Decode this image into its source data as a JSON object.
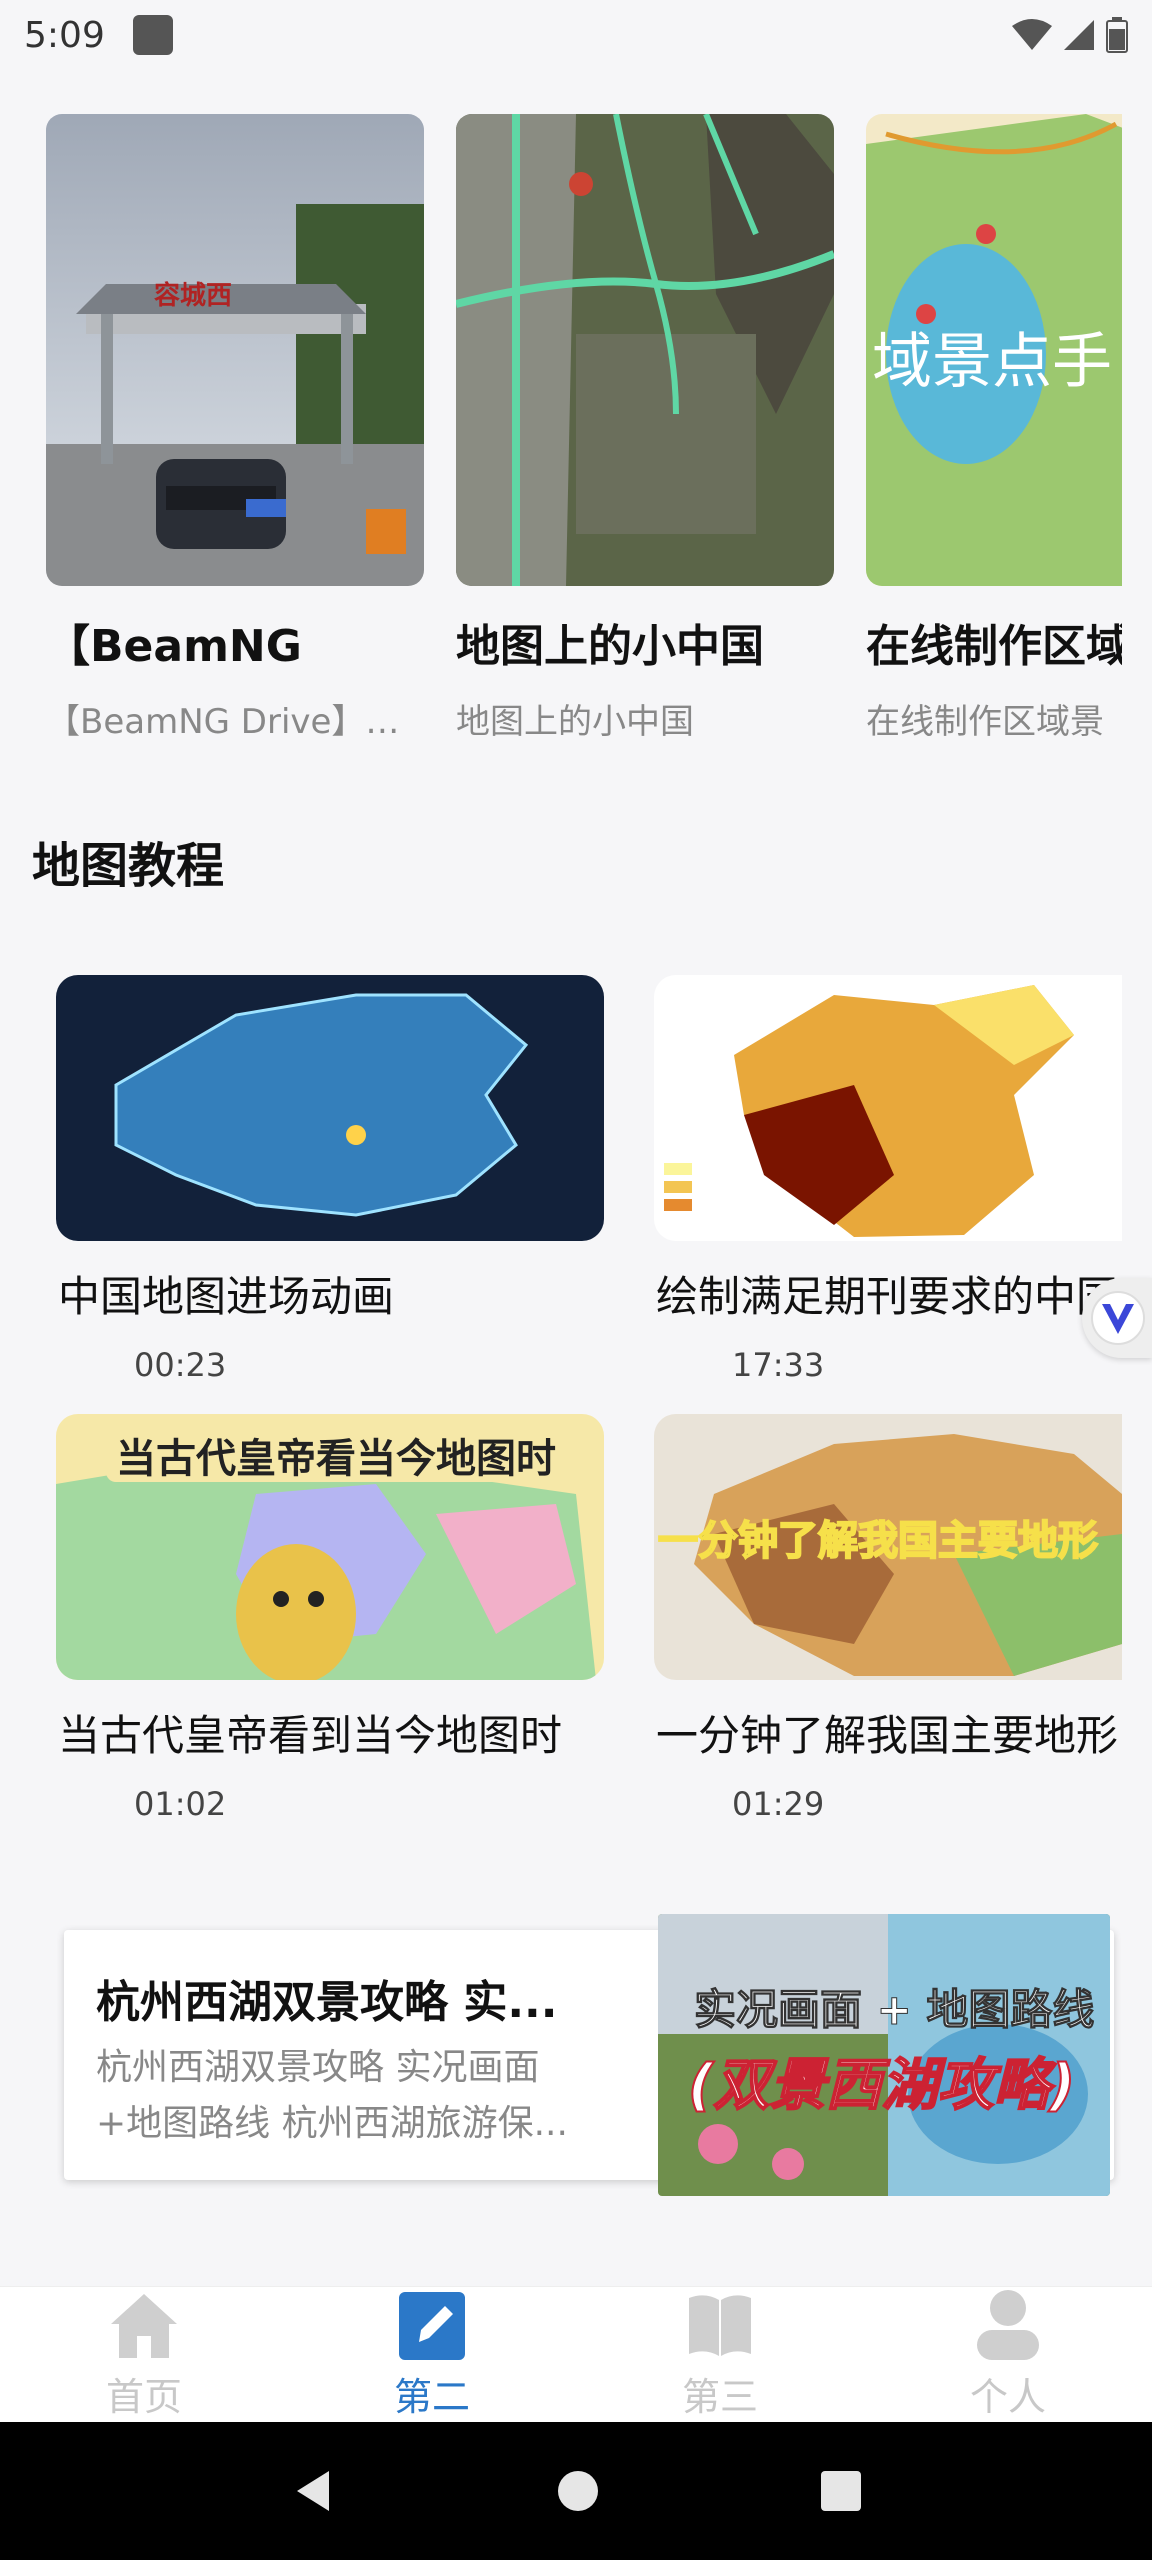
{
  "status": {
    "time": "5:09"
  },
  "carousel": [
    {
      "title": "【BeamNG",
      "subtitle": "【BeamNG Drive】…",
      "thumb_text": "容城西"
    },
    {
      "title": "地图上的小中国",
      "subtitle": "地图上的小中国"
    },
    {
      "title": "在线制作区域",
      "subtitle": "在线制作区域景",
      "thumb_text": "域景点手"
    }
  ],
  "section": {
    "title": "地图教程"
  },
  "videos": [
    {
      "title": "中国地图进场动画",
      "duration": "00:23"
    },
    {
      "title": "绘制满足期刊要求的中国",
      "duration": "17:33"
    },
    {
      "title": "当古代皇帝看到当今地图时",
      "duration": "01:02",
      "thumb_text": "当古代皇帝看当今地图时"
    },
    {
      "title": "一分钟了解我国主要地形",
      "duration": "01:29",
      "thumb_text": "一分钟了解我国主要地形"
    }
  ],
  "feature": {
    "title": "杭州西湖双景攻略 实...",
    "desc_line1": "杭州西湖双景攻略 实况画面",
    "desc_line2": "+地图路线 杭州西湖旅游保...",
    "thumb_line1": "实况画面 + 地图路线",
    "thumb_line2": "(双景西湖攻略)"
  },
  "nav": [
    {
      "label": "首页",
      "icon": "home-icon",
      "active": false
    },
    {
      "label": "第二",
      "icon": "edit-icon",
      "active": true
    },
    {
      "label": "第三",
      "icon": "book-icon",
      "active": false
    },
    {
      "label": "个人",
      "icon": "person-icon",
      "active": false
    }
  ],
  "colors": {
    "accent": "#2b78c8",
    "nav_inactive": "#c8c8c8"
  }
}
